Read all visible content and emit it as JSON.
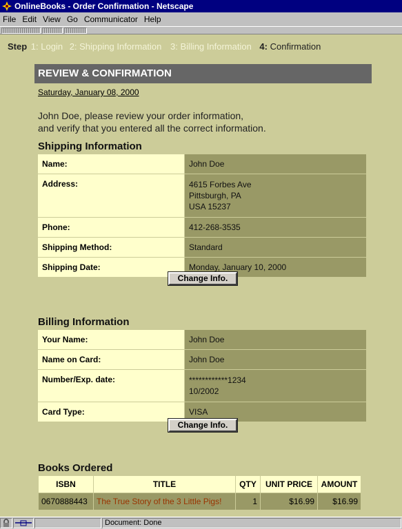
{
  "window": {
    "title": "OnlineBooks - Order Confirmation - Netscape"
  },
  "menu": [
    "File",
    "Edit",
    "View",
    "Go",
    "Communicator",
    "Help"
  ],
  "steps": {
    "lead": "Step",
    "items": [
      "1: Login",
      "2: Shipping Information",
      "3: Billing Information"
    ],
    "current_num": "4:",
    "current_label": "Confirmation"
  },
  "header": {
    "title": "REVIEW & CONFIRMATION",
    "date": "Saturday, January 08, 2000",
    "intro_line1": "John Doe, please review your order information,",
    "intro_line2": "and verify that you entered all the correct information."
  },
  "shipping": {
    "heading": "Shipping Information",
    "rows": [
      {
        "label": "Name:",
        "value": "John Doe"
      },
      {
        "label": "Address:",
        "lines": [
          "4615 Forbes Ave",
          "Pittsburgh, PA",
          "USA 15237"
        ]
      },
      {
        "label": "Phone:",
        "value": "412-268-3535"
      },
      {
        "label": "Shipping Method:",
        "value": "Standard"
      },
      {
        "label": "Shipping Date:",
        "value": "Monday, January 10, 2000"
      }
    ],
    "button": "Change Info."
  },
  "billing": {
    "heading": "Billing Information",
    "rows": [
      {
        "label": "Your Name:",
        "value": "John Doe"
      },
      {
        "label": "Name on Card:",
        "value": "John Doe"
      },
      {
        "label": "Number/Exp. date:",
        "lines": [
          "************1234",
          "10/2002"
        ]
      },
      {
        "label": "Card Type:",
        "value": "VISA"
      }
    ],
    "button": "Change Info."
  },
  "books": {
    "heading": "Books Ordered",
    "columns": [
      "ISBN",
      "TITLE",
      "QTY",
      "UNIT PRICE",
      "AMOUNT"
    ],
    "rows": [
      {
        "isbn": "0670888443",
        "title": "The True Story of the 3 Little Pigs!",
        "qty": "1",
        "unit_price": "$16.99",
        "amount": "$16.99"
      }
    ]
  },
  "status": {
    "text": "Document: Done"
  },
  "colors": {
    "page_bg": "#cccc99",
    "label_bg": "#ffffcc",
    "value_bg": "#999966",
    "band_bg": "#666666",
    "link": "#993300"
  }
}
